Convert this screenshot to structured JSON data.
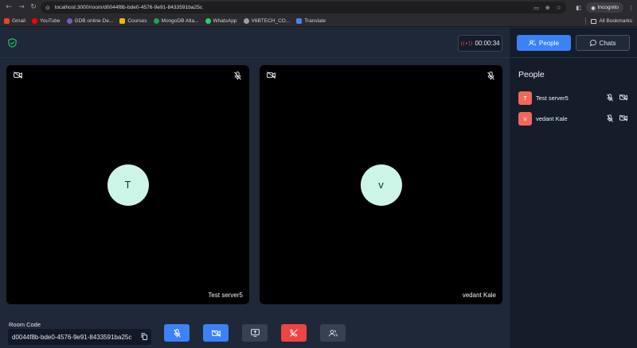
{
  "browser": {
    "url": "localhost:3000/room/d0044f8b-bde0-4576-9e91-8433591ba25c",
    "profile": "Incognito",
    "bookmarks": [
      {
        "label": "Gmail",
        "color": "#ea4335"
      },
      {
        "label": "YouTube",
        "color": "#ff0000"
      },
      {
        "label": "GDB online De...",
        "color": "#7e57c2"
      },
      {
        "label": "Courses",
        "color": "#f4b400"
      },
      {
        "label": "MongoDB Atla...",
        "color": "#13aa52"
      },
      {
        "label": "WhatsApp",
        "color": "#25d366"
      },
      {
        "label": "V6BTECH_CO...",
        "color": "#9e9e9e"
      },
      {
        "label": "Translate",
        "color": "#4285f4"
      }
    ],
    "all_bookmarks": "All Bookmarks"
  },
  "header": {
    "timer": "00:00:34"
  },
  "tiles": [
    {
      "initial": "T",
      "name": "Test server5"
    },
    {
      "initial": "v",
      "name": "vedant Kale"
    }
  ],
  "room": {
    "label": "Room Code",
    "code": "d0044f8b-bde0-4576-9e91-8433591ba25c"
  },
  "sidebar": {
    "tabs": {
      "people": "People",
      "chats": "Chats"
    },
    "title": "People",
    "participants": [
      {
        "initial": "T",
        "name": "Test server5"
      },
      {
        "initial": "v",
        "name": "vedant Kale"
      }
    ]
  },
  "colors": {
    "accent": "#3b82f6",
    "danger": "#ef4444",
    "avatar_bg": "#ccf5e8",
    "participant_avatar": "#f0685a"
  }
}
